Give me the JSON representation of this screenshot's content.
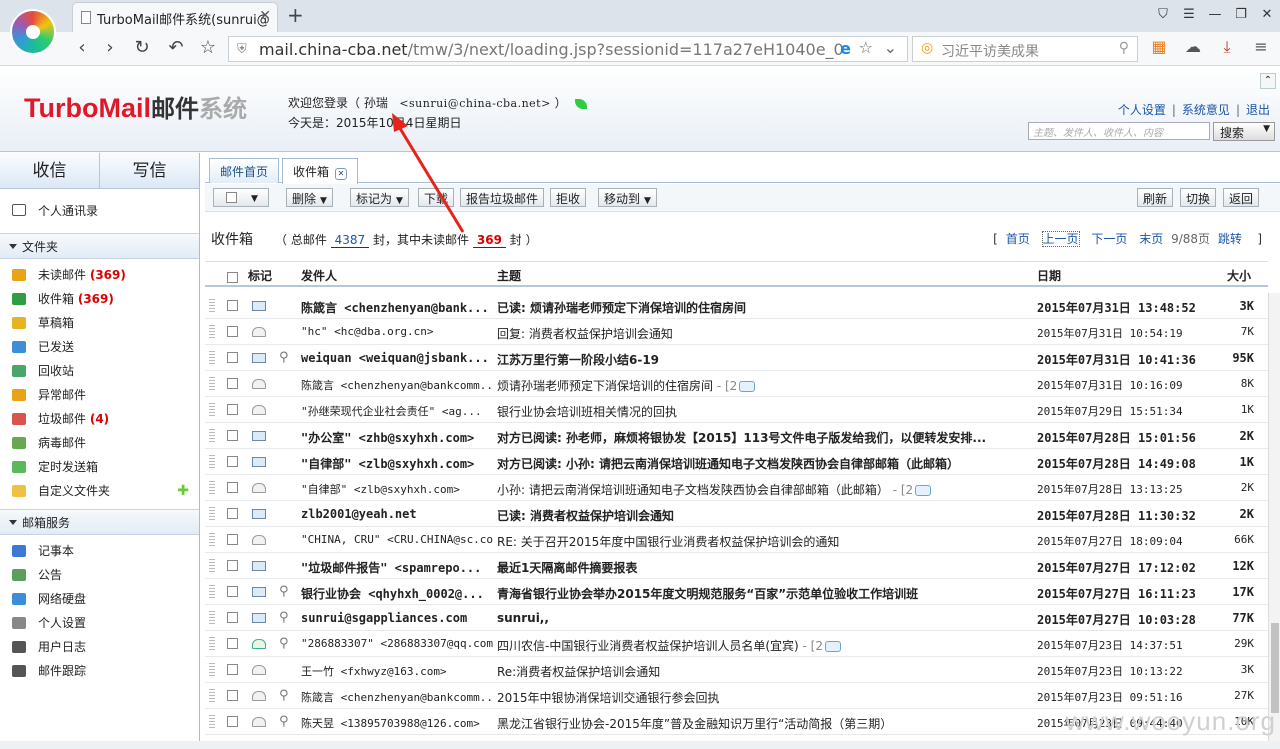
{
  "browser": {
    "tab_title": "TurboMail邮件系统(sunrui@",
    "url_host": "mail.china-cba.net",
    "url_path": "/tmw/3/next/loading.jsp?sessionid=117a27eH1040e_0",
    "search_text": "习近平访美成果"
  },
  "header": {
    "brand_en": "TurboMail",
    "brand_cn1": "邮件",
    "brand_cn2": "系统",
    "welcome_prefix": "欢迎您登录（",
    "user_name": "孙瑞",
    "user_email": "<sunrui@china-cba.net>",
    "welcome_suffix": "）",
    "today": "今天是：2015年10月4日星期日",
    "link_settings": "个人设置",
    "link_feedback": "系统意见",
    "link_logout": "退出",
    "search_placeholder": "主题、发件人、收件人、内容",
    "search_button": "搜索"
  },
  "sidebar": {
    "receive": "收信",
    "write": "写信",
    "contacts": "个人通讯录",
    "folders_title": "文件夹",
    "folders": [
      {
        "label": "未读邮件",
        "count": "(369)",
        "color": "#e8a317"
      },
      {
        "label": "收件箱",
        "count": "(369)",
        "color": "#2e9e45"
      },
      {
        "label": "草稿箱",
        "count": "",
        "color": "#e6b422"
      },
      {
        "label": "已发送",
        "count": "",
        "color": "#3c8ed8"
      },
      {
        "label": "回收站",
        "count": "",
        "color": "#4aa56a"
      },
      {
        "label": "异常邮件",
        "count": "",
        "color": "#e8a317"
      },
      {
        "label": "垃圾邮件",
        "count": "(4)",
        "color": "#d9534f"
      },
      {
        "label": "病毒邮件",
        "count": "",
        "color": "#6aa84f"
      },
      {
        "label": "定时发送箱",
        "count": "",
        "color": "#5cb85c"
      },
      {
        "label": "自定义文件夹",
        "count": "",
        "color": "#f0c040"
      }
    ],
    "services_title": "邮箱服务",
    "services": [
      {
        "label": "记事本",
        "color": "#3c78d8"
      },
      {
        "label": "公告",
        "color": "#5aa05a"
      },
      {
        "label": "网络硬盘",
        "color": "#3c8ed8"
      },
      {
        "label": "个人设置",
        "color": "#888888"
      },
      {
        "label": "用户日志",
        "color": "#555555"
      },
      {
        "label": "邮件跟踪",
        "color": "#555555"
      }
    ]
  },
  "main": {
    "tab_home": "邮件首页",
    "tab_inbox": "收件箱",
    "toolbar": {
      "delete": "删除",
      "mark_as": "标记为",
      "download": "下载",
      "report_spam": "报告垃圾邮件",
      "reject": "拒收",
      "move_to": "移动到",
      "refresh": "刷新",
      "switch": "切换",
      "back": "返回"
    },
    "summary": {
      "label": "收件箱",
      "total_prefix": "（ 总邮件",
      "total": "4387",
      "mid": "封，其中未读邮件",
      "unread": "369",
      "suffix": "封 ）"
    },
    "pager": {
      "open": "[",
      "first": "首页",
      "prev": "上一页",
      "next": "下一页",
      "last": "末页",
      "page_info": "9/88页",
      "jump": "跳转",
      "close": "]"
    },
    "columns": {
      "flag": "标记",
      "from": "发件人",
      "subject": "主题",
      "date": "日期",
      "size": "大小"
    },
    "rows": [
      {
        "unread": true,
        "icon": "new",
        "clip": false,
        "from": "陈箴言 <chenzhenyan@bank...",
        "subject": "已读: 烦请孙瑞老师预定下消保培训的住宿房间",
        "date": "2015年07月31日 13:48:52",
        "size": "3K"
      },
      {
        "unread": false,
        "icon": "read",
        "clip": false,
        "from": "\"hc\" <hc@dba.org.cn>",
        "subject": "回复: 消费者权益保护培训会通知",
        "date": "2015年07月31日 10:54:19",
        "size": "7K"
      },
      {
        "unread": true,
        "icon": "new",
        "clip": true,
        "from": "weiquan <weiquan@jsbank...",
        "subject": "江苏万里行第一阶段小结6-19",
        "date": "2015年07月31日 10:41:36",
        "size": "95K"
      },
      {
        "unread": false,
        "icon": "read",
        "clip": false,
        "from": "陈箴言 <chenzhenyan@bankcomm...",
        "subject": "烦请孙瑞老师预定下消保培训的住宿房间",
        "thread": "- [2",
        "date": "2015年07月31日 10:16:09",
        "size": "8K"
      },
      {
        "unread": false,
        "icon": "read",
        "clip": false,
        "from": "\"孙继荣现代企业社会责任\" <ag...",
        "subject": "银行业协会培训班相关情况的回执",
        "date": "2015年07月29日 15:51:34",
        "size": "1K"
      },
      {
        "unread": true,
        "icon": "new",
        "clip": false,
        "from": "\"办公室\" <zhb@sxyhxh.com>",
        "subject": "对方已阅读: 孙老师，麻烦将银协发【2015】113号文件电子版发给我们，以便转发安排...",
        "date": "2015年07月28日 15:01:56",
        "size": "2K"
      },
      {
        "unread": true,
        "icon": "new",
        "clip": false,
        "from": "\"自律部\" <zlb@sxyhxh.com>",
        "subject": "对方已阅读: 小孙: 请把云南消保培训班通知电子文档发陕西协会自律部邮箱（此邮箱）",
        "date": "2015年07月28日 14:49:08",
        "size": "1K"
      },
      {
        "unread": false,
        "icon": "read",
        "clip": false,
        "from": "\"自律部\" <zlb@sxyhxh.com>",
        "subject": "小孙: 请把云南消保培训班通知电子文档发陕西协会自律部邮箱（此邮箱）",
        "thread": "- [2",
        "date": "2015年07月28日 13:13:25",
        "size": "2K"
      },
      {
        "unread": true,
        "icon": "new",
        "clip": false,
        "from": "zlb2001@yeah.net",
        "subject": "已读: 消费者权益保护培训会通知",
        "date": "2015年07月28日 11:30:32",
        "size": "2K"
      },
      {
        "unread": false,
        "icon": "read",
        "clip": false,
        "from": "\"CHINA, CRU\" <CRU.CHINA@sc.com>",
        "subject": "RE: 关于召开2015年度中国银行业消费者权益保护培训会的通知",
        "date": "2015年07月27日 18:09:04",
        "size": "66K"
      },
      {
        "unread": true,
        "icon": "new",
        "clip": false,
        "from": "\"垃圾邮件报告\" <spamrepo...",
        "subject": "最近1天隔离邮件摘要报表",
        "date": "2015年07月27日 17:12:02",
        "size": "12K"
      },
      {
        "unread": true,
        "icon": "new",
        "clip": true,
        "from": "银行业协会 <qhyhxh_0002@...",
        "subject": "青海省银行业协会举办2015年度文明规范服务“百家”示范单位验收工作培训班",
        "date": "2015年07月27日 16:11:23",
        "size": "17K"
      },
      {
        "unread": true,
        "icon": "new",
        "clip": true,
        "from": "sunrui@sgappliances.com",
        "subject": "sunrui,,",
        "date": "2015年07月27日 10:03:28",
        "size": "77K"
      },
      {
        "unread": false,
        "icon": "fwd",
        "clip": true,
        "from": "\"286883307\" <286883307@qq.com>",
        "subject": "四川农信-中国银行业消费者权益保护培训人员名单(宜宾)",
        "thread": "- [2",
        "date": "2015年07月23日 14:37:51",
        "size": "29K"
      },
      {
        "unread": false,
        "icon": "read",
        "clip": false,
        "from": "王一竹 <fxhwyz@163.com>",
        "subject": "Re:消费者权益保护培训会通知",
        "date": "2015年07月23日 10:13:22",
        "size": "3K"
      },
      {
        "unread": false,
        "icon": "read",
        "clip": true,
        "from": "陈箴言 <chenzhenyan@bankcomm...",
        "subject": "2015年中银协消保培训交通银行参会回执",
        "date": "2015年07月23日 09:51:16",
        "size": "27K"
      },
      {
        "unread": false,
        "icon": "read",
        "clip": true,
        "from": "陈天昱 <13895703988@126.com>",
        "subject": "黑龙江省银行业协会-2015年度”普及金融知识万里行“活动简报（第三期）",
        "date": "2015年07月23日 09:44:40",
        "size": "10K"
      }
    ]
  },
  "watermark": "www.wooyun.org"
}
